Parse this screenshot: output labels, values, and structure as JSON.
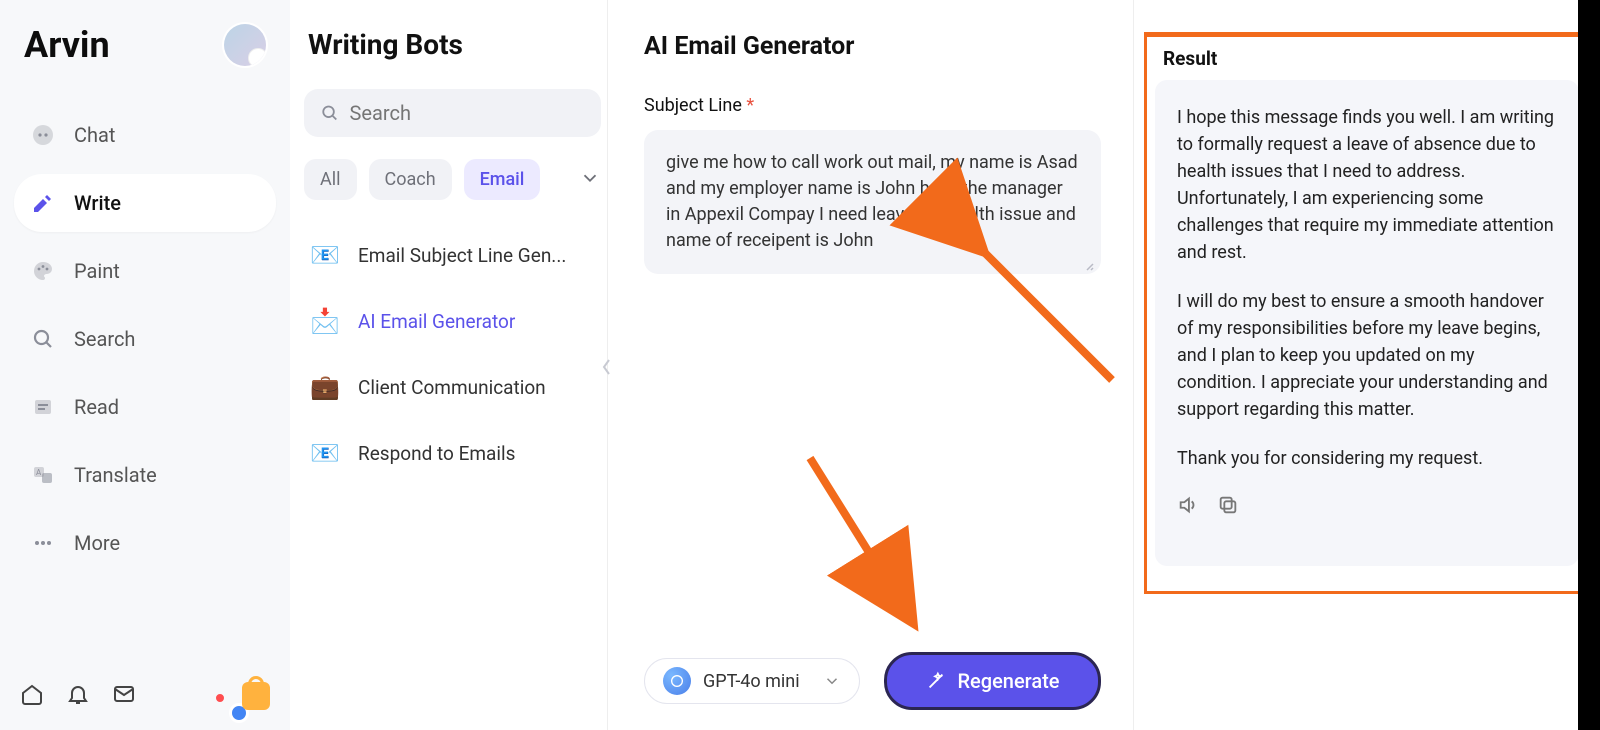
{
  "brand": "Arvin",
  "nav": {
    "chat": "Chat",
    "write": "Write",
    "paint": "Paint",
    "search": "Search",
    "read": "Read",
    "translate": "Translate",
    "more": "More"
  },
  "bots": {
    "title": "Writing Bots",
    "search_placeholder": "Search",
    "filters": {
      "all": "All",
      "coach": "Coach",
      "email": "Email"
    },
    "items": [
      {
        "label": "Email Subject Line Gen..."
      },
      {
        "label": "AI Email Generator"
      },
      {
        "label": "Client Communication"
      },
      {
        "label": "Respond to Emails"
      }
    ]
  },
  "form": {
    "title": "AI Email Generator",
    "subject_label": "Subject Line",
    "subject_value": "give me how to call work out mail, my name is Asad and my employer name is John he is the manager in Appexil Compay I need leave for health issue and name of receipent is John",
    "model": "GPT-4o mini",
    "regenerate": "Regenerate"
  },
  "result": {
    "title": "Result",
    "para1": "I hope this message finds you well. I am writing to formally request a leave of absence due to health issues that I need to address. Unfortunately, I am experiencing some challenges that require my immediate attention and rest.",
    "para2": "I will do my best to ensure a smooth handover of my responsibilities before my leave begins, and I plan to keep you updated on my condition. I appreciate your understanding and support regarding this matter.",
    "para3": "Thank you for considering my request."
  }
}
